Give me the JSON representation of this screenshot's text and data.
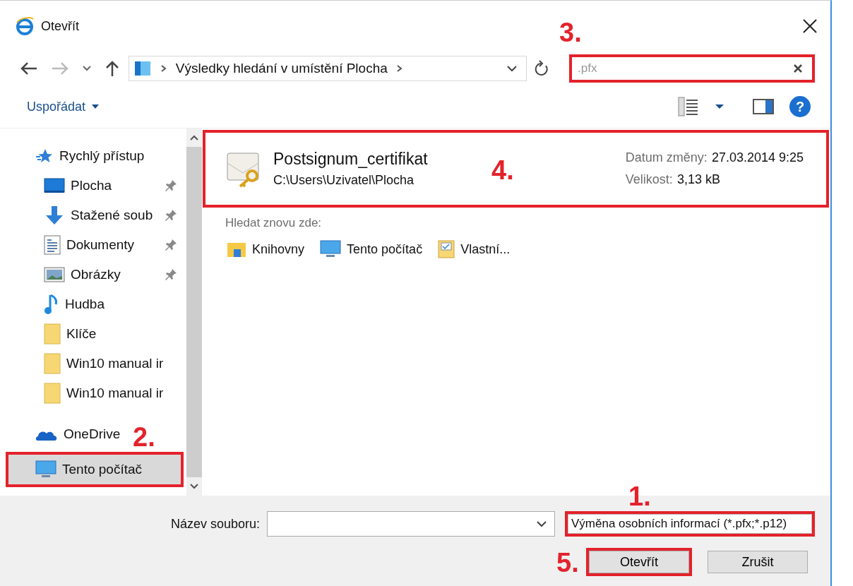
{
  "window": {
    "title": "Otevřít"
  },
  "address": {
    "path": "Výsledky hledání v umístění Plocha"
  },
  "search": {
    "value": ".pfx",
    "annotation": "3."
  },
  "toolbar": {
    "organize": "Uspořádat",
    "help": "?"
  },
  "sidebar": {
    "items": [
      {
        "label": "Rychlý přístup",
        "kind": "star",
        "selected": false,
        "children": [
          {
            "label": "Plocha",
            "kind": "desktop",
            "pinned": true,
            "selected": false
          },
          {
            "label": "Stažené soub",
            "kind": "download",
            "pinned": true,
            "selected": false
          },
          {
            "label": "Dokumenty",
            "kind": "document",
            "pinned": true,
            "selected": false
          },
          {
            "label": "Obrázky",
            "kind": "picture",
            "pinned": true,
            "selected": false
          },
          {
            "label": "Hudba",
            "kind": "music",
            "pinned": false,
            "selected": false
          },
          {
            "label": "Klíče",
            "kind": "folder",
            "pinned": false,
            "selected": false
          },
          {
            "label": "Win10 manual ir",
            "kind": "folder",
            "pinned": false,
            "selected": false
          },
          {
            "label": "Win10 manual ir",
            "kind": "folder",
            "pinned": false,
            "selected": false
          }
        ]
      },
      {
        "label": "OneDrive",
        "kind": "cloud",
        "selected": false,
        "annotation": "2."
      },
      {
        "label": "Tento počítač",
        "kind": "computer",
        "selected": true,
        "annotation_frame": true
      }
    ]
  },
  "results": [
    {
      "name": "Postsignum_certifikat",
      "path": "C:\\Users\\Uzivatel\\Plocha",
      "date_label": "Datum změny:",
      "date": "27.03.2014 9:25",
      "size_label": "Velikost:",
      "size": "3,13 kB",
      "annotation": "4."
    }
  ],
  "search_again": {
    "label": "Hledat znovu zde:",
    "locations": [
      {
        "label": "Knihovny",
        "kind": "libraries"
      },
      {
        "label": "Tento počítač",
        "kind": "computer"
      },
      {
        "label": "Vlastní...",
        "kind": "custom"
      }
    ]
  },
  "footer": {
    "filename_label": "Název souboru:",
    "filter": "Výměna osobních informací (*.pfx;*.p12)",
    "filter_annotation": "1.",
    "buttons": [
      {
        "label": "Otevřít",
        "annotation": "5."
      },
      {
        "label": "Zrušit"
      }
    ]
  }
}
